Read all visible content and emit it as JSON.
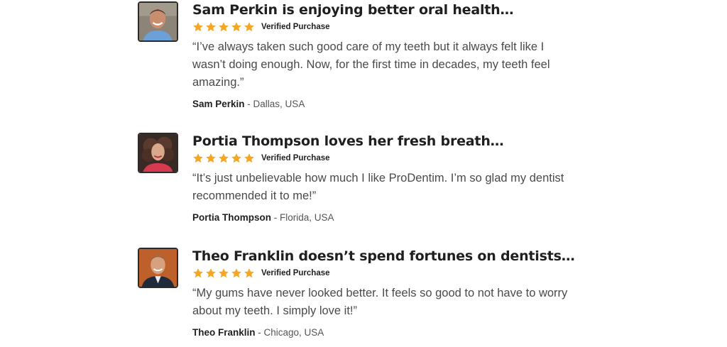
{
  "colors": {
    "star": "#F5A623",
    "title": "#1f1f1f",
    "quote": "#4a4a4a",
    "avatar_border": "#2b2b2b"
  },
  "reviews": [
    {
      "title": "Sam Perkin is enjoying better oral health…",
      "rating": 5,
      "verified_label": "Verified Purchase",
      "quote": "“I’ve always taken such good care of my teeth but it always felt like I wasn’t doing enough. Now, for the first time in decades, my teeth feel amazing.”",
      "author_name": "Sam Perkin",
      "author_location": " - Dallas, USA",
      "avatar_icon": "avatar-photo-man-smiling"
    },
    {
      "title": "Portia Thompson loves her fresh breath…",
      "rating": 5,
      "verified_label": "Verified Purchase",
      "quote": "“It’s just unbelievable how much I like ProDentim. I’m so glad my dentist recommended it to me!”",
      "author_name": "Portia Thompson",
      "author_location": " - Florida, USA",
      "avatar_icon": "avatar-photo-woman-curly-hair"
    },
    {
      "title": "Theo Franklin doesn’t spend fortunes on dentists…",
      "rating": 5,
      "verified_label": "Verified Purchase",
      "quote": "“My gums have never looked better. It feels so good to not have to worry about my teeth. I simply love it!”",
      "author_name": "Theo Franklin",
      "author_location": " - Chicago, USA",
      "avatar_icon": "avatar-photo-man-suit"
    }
  ]
}
